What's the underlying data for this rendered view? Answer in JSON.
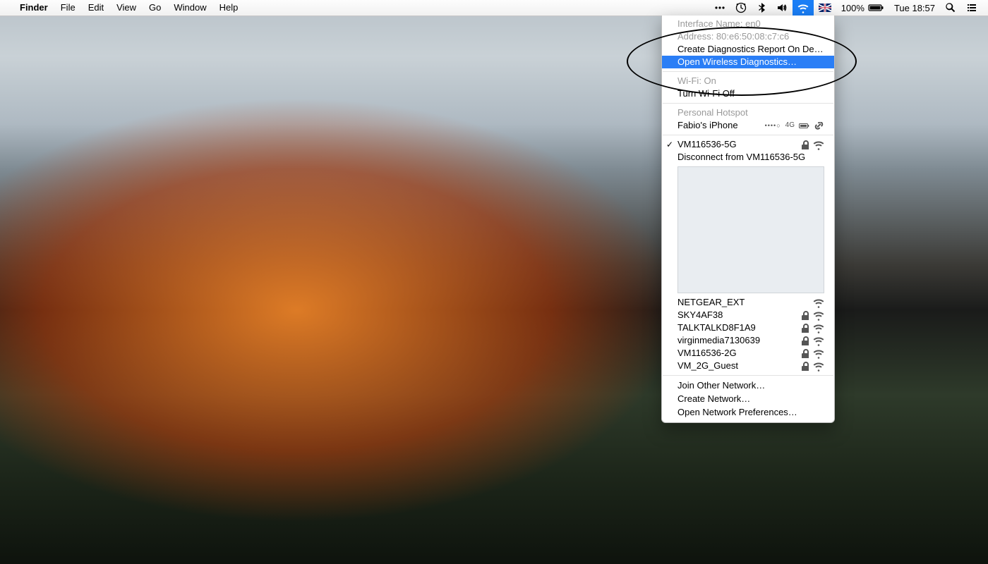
{
  "menubar": {
    "apple_glyph": "",
    "app": "Finder",
    "items": [
      "File",
      "Edit",
      "View",
      "Go",
      "Window",
      "Help"
    ],
    "status": {
      "battery_pct": "100%",
      "clock": "Tue 18:57"
    }
  },
  "wifi_menu": {
    "interface_label": "Interface Name: en0",
    "address_label": "Address: 80:e6:50:08:c7:c6",
    "create_diag": "Create Diagnostics Report On Desktop…",
    "open_diag": "Open Wireless Diagnostics…",
    "wifi_status": "Wi-Fi: On",
    "turn_off": "Turn Wi-Fi Off",
    "hotspot_header": "Personal Hotspot",
    "hotspot_name": "Fabio's iPhone",
    "hotspot_signal": "••••○",
    "hotspot_net": "4G",
    "connected_name": "VM116536-5G",
    "disconnect": "Disconnect from VM116536-5G",
    "networks": [
      {
        "name": "NETGEAR_EXT",
        "locked": false
      },
      {
        "name": "SKY4AF38",
        "locked": true
      },
      {
        "name": "TALKTALKD8F1A9",
        "locked": true
      },
      {
        "name": "virginmedia7130639",
        "locked": true
      },
      {
        "name": "VM116536-2G",
        "locked": true
      },
      {
        "name": "VM_2G_Guest",
        "locked": true
      }
    ],
    "join_other": "Join Other Network…",
    "create_net": "Create Network…",
    "open_prefs": "Open Network Preferences…"
  }
}
